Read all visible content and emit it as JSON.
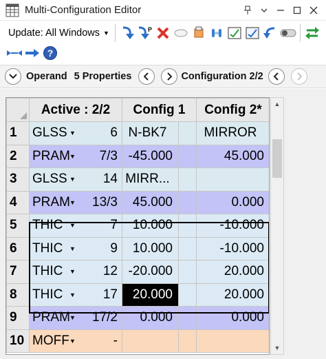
{
  "window": {
    "title": "Multi-Configuration Editor",
    "controls": [
      "pin-icon",
      "chevron-down-icon",
      "minimize-icon",
      "maximize-icon",
      "close-icon"
    ]
  },
  "toolbar": {
    "update_label": "Update: All Windows",
    "icons_row1": [
      "insert-operand-icon",
      "insert-after-icon",
      "delete-operand-icon",
      "clear-icon",
      "make-thermal-icon",
      "slider-icon",
      "pick-up-icon",
      "check-icon",
      "undo-icon",
      "toggle-icon",
      "swap-icon"
    ],
    "icons_row2": [
      "expand-icon",
      "arrow-right-icon",
      "help-icon"
    ],
    "insert_after_badge": "P"
  },
  "navbar": {
    "operand_label": "Operand",
    "properties_label": "5 Properties",
    "configuration_label": "Configuration 2/2"
  },
  "grid": {
    "headers": {
      "active": "Active : 2/2",
      "config1": "Config 1",
      "config2": "Config 2*"
    },
    "rows": [
      {
        "num": "1",
        "op": "GLSS",
        "param": "6",
        "c1": "N-BK7",
        "c2": "MIRROR",
        "kind": "glss"
      },
      {
        "num": "2",
        "op": "PRAM",
        "param": "7/3",
        "c1": "-45.000",
        "c2": "45.000",
        "kind": "pram"
      },
      {
        "num": "3",
        "op": "GLSS",
        "param": "14",
        "c1": "MIRR...",
        "c2": "",
        "kind": "glss"
      },
      {
        "num": "4",
        "op": "PRAM",
        "param": "13/3",
        "c1": "45.000",
        "c2": "0.000",
        "kind": "pram"
      },
      {
        "num": "5",
        "op": "THIC",
        "param": "7",
        "c1": "10.000",
        "c2": "-10.000",
        "kind": "thic"
      },
      {
        "num": "6",
        "op": "THIC",
        "param": "9",
        "c1": "10.000",
        "c2": "-10.000",
        "kind": "thic"
      },
      {
        "num": "7",
        "op": "THIC",
        "param": "12",
        "c1": "-20.000",
        "c2": "20.000",
        "kind": "thic"
      },
      {
        "num": "8",
        "op": "THIC",
        "param": "17",
        "c1": "20.000",
        "c2": "20.000",
        "kind": "thic"
      },
      {
        "num": "9",
        "op": "PRAM",
        "param": "17/2",
        "c1": "0.000",
        "c2": "0.000",
        "kind": "pram"
      },
      {
        "num": "10",
        "op": "MOFF",
        "param": "-",
        "c1": "",
        "c2": "",
        "kind": "moff"
      }
    ]
  },
  "colors": {
    "glss_row": "#daeaf0",
    "pram_row": "#c3c3f7",
    "thic_row": "#dbeaf4",
    "moff_row": "#fbd9bc",
    "selection": "#000000"
  }
}
